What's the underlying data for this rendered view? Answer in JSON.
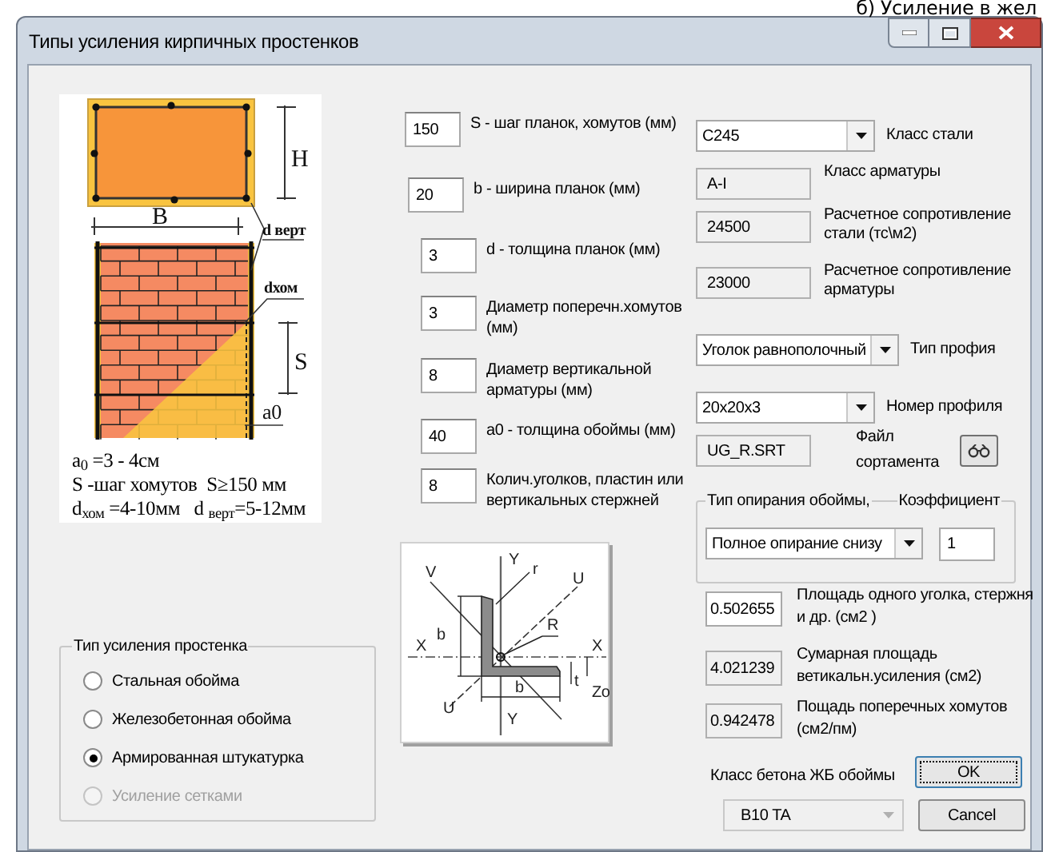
{
  "background_caption": "б) Усиление в жел",
  "window": {
    "title": "Типы усиления кирпичных простенков"
  },
  "wall_drawing": {
    "labels": [
      "H",
      "B",
      "d верт",
      "dхом",
      "S",
      "a0"
    ],
    "notes": [
      "a$_{0}$ =3 - 4см",
      "S -шаг хомутов  S≥150 мм",
      "d$_{хом}$ =4-10мм   d $_{верт}$=5-12мм"
    ]
  },
  "reinforcement_type": {
    "title": "Тип усиления простенка",
    "options": [
      {
        "label": "Стальная обойма",
        "selected": false,
        "disabled": false
      },
      {
        "label": "Железобетонная обойма",
        "selected": false,
        "disabled": false
      },
      {
        "label": "Армированная штукатурка",
        "selected": true,
        "disabled": false
      },
      {
        "label": "Усиление сетками",
        "selected": false,
        "disabled": true
      }
    ]
  },
  "parameters": [
    {
      "value": "150",
      "label": "S - шаг планок, хомутов (мм)"
    },
    {
      "value": "20",
      "label": "b - ширина планок (мм)"
    },
    {
      "value": "3",
      "label": "d - толщина планок (мм)"
    },
    {
      "value": "3",
      "label": "Диаметр поперечн.хомутов (мм)"
    },
    {
      "value": "8",
      "label": "Диаметр вертикальной арматуры (мм)"
    },
    {
      "value": "40",
      "label": "a0 - толщина обоймы (мм)"
    },
    {
      "value": "8",
      "label": "Колич.уголков, пластин или вертикальных стержней"
    }
  ],
  "properties": [
    {
      "kind": "combo",
      "value": "C245",
      "label": "Класс стали"
    },
    {
      "kind": "readonly",
      "value": "A-I",
      "label": "Класс арматуры"
    },
    {
      "kind": "readonly",
      "value": "24500",
      "label": "Расчетное сопротивление стали (тс\\м2)"
    },
    {
      "kind": "readonly",
      "value": "23000",
      "label": "Расчетное сопротивление арматуры"
    },
    {
      "kind": "combo",
      "value": "Уголок равнополочный",
      "label": "Тип профия"
    },
    {
      "kind": "combo",
      "value": "20x20x3",
      "label": "Номер профиля"
    },
    {
      "kind": "file",
      "value": "UG_R.SRT",
      "label": "Файл сортамента"
    }
  ],
  "support": {
    "title": "Тип опирания обоймы,",
    "coefficient_label": "Коэффициент",
    "type_value": "Полное опирание снизу",
    "coefficient_value": "1"
  },
  "angle_drawing": {
    "labels": [
      "V",
      "Y",
      "r",
      "U",
      "X",
      "b",
      "R",
      "X",
      "t",
      "Zo",
      "U",
      "b",
      "Y"
    ]
  },
  "results": [
    {
      "value": "0.502655",
      "label": "Площадь одного уголка, стержня и др.  (см2 )",
      "readonly": false
    },
    {
      "value": "4.021239",
      "label": "Сумарная площадь ветикальн.усиления  (см2)",
      "readonly": true
    },
    {
      "value": "0.942478",
      "label": "Пощадь поперечных хомутов (см2/пм)",
      "readonly": true
    }
  ],
  "concrete": {
    "label": "Класс бетона ЖБ обоймы",
    "value": "B10 TA",
    "disabled": true
  },
  "buttons": [
    {
      "label": "OK",
      "default": true
    },
    {
      "label": "Cancel",
      "default": false
    }
  ]
}
